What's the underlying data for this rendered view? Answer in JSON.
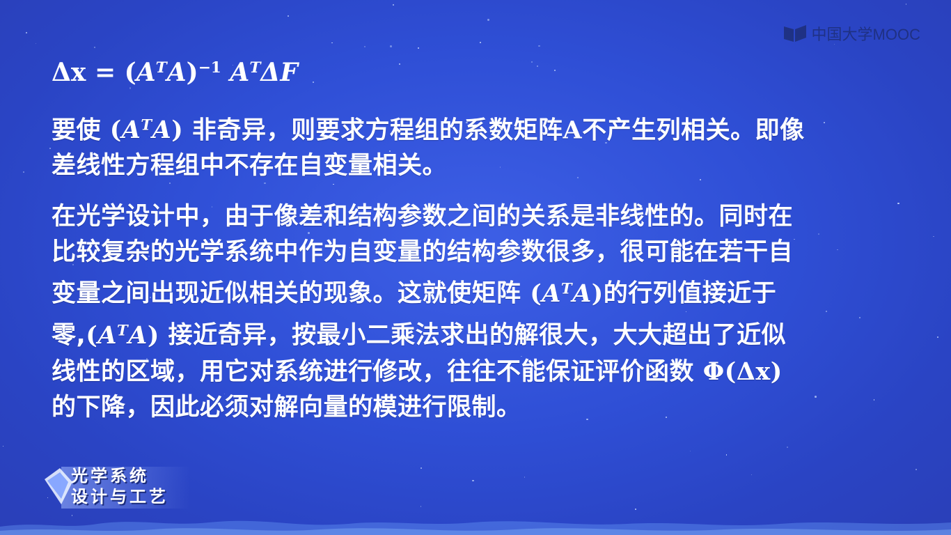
{
  "logo": {
    "text": "中国大学MOOC",
    "icon": "book-icon"
  },
  "formula": {
    "delta_x": "Δx",
    "equals": "=",
    "matrix": "A",
    "transpose": "T",
    "inverse": "−1",
    "delta_f": "ΔF"
  },
  "para1": {
    "line1_a": "要使",
    "line1_b": "非奇异，则要求方程组的系数矩阵",
    "line1_c": "不产生列相关。即像",
    "line2": "差线性方程组中不存在自变量相关。"
  },
  "para2": {
    "line1": "在光学设计中，由于像差和结构参数之间的关系是非线性的。同时在",
    "line2": "比较复杂的光学系统中作为自变量的结构参数很多，很可能在若干自",
    "line3_a": "变量之间出现近似相关的现象。这就使矩阵",
    "line3_b": "的行列值接近于",
    "line4_a": "零,",
    "line4_b": "接近奇异，按最小二乘法求出的解很大，大大超出了近似",
    "line5_a": "线性的区域，用它对系统进行修改，往往不能保证评价函数",
    "line5_b": "Φ(Δx)",
    "line6": "的下降，因此必须对解向量的模进行限制。"
  },
  "matrix_expr": {
    "open": "(",
    "a": "A",
    "t": "T",
    "close": ")"
  },
  "brand": {
    "line1": "光学系统",
    "line2": "设计与工艺",
    "icon": "diamond-logo-icon"
  },
  "colors": {
    "background": "#3452dc",
    "text": "#ffffff",
    "logo": "#1b2a6b"
  }
}
